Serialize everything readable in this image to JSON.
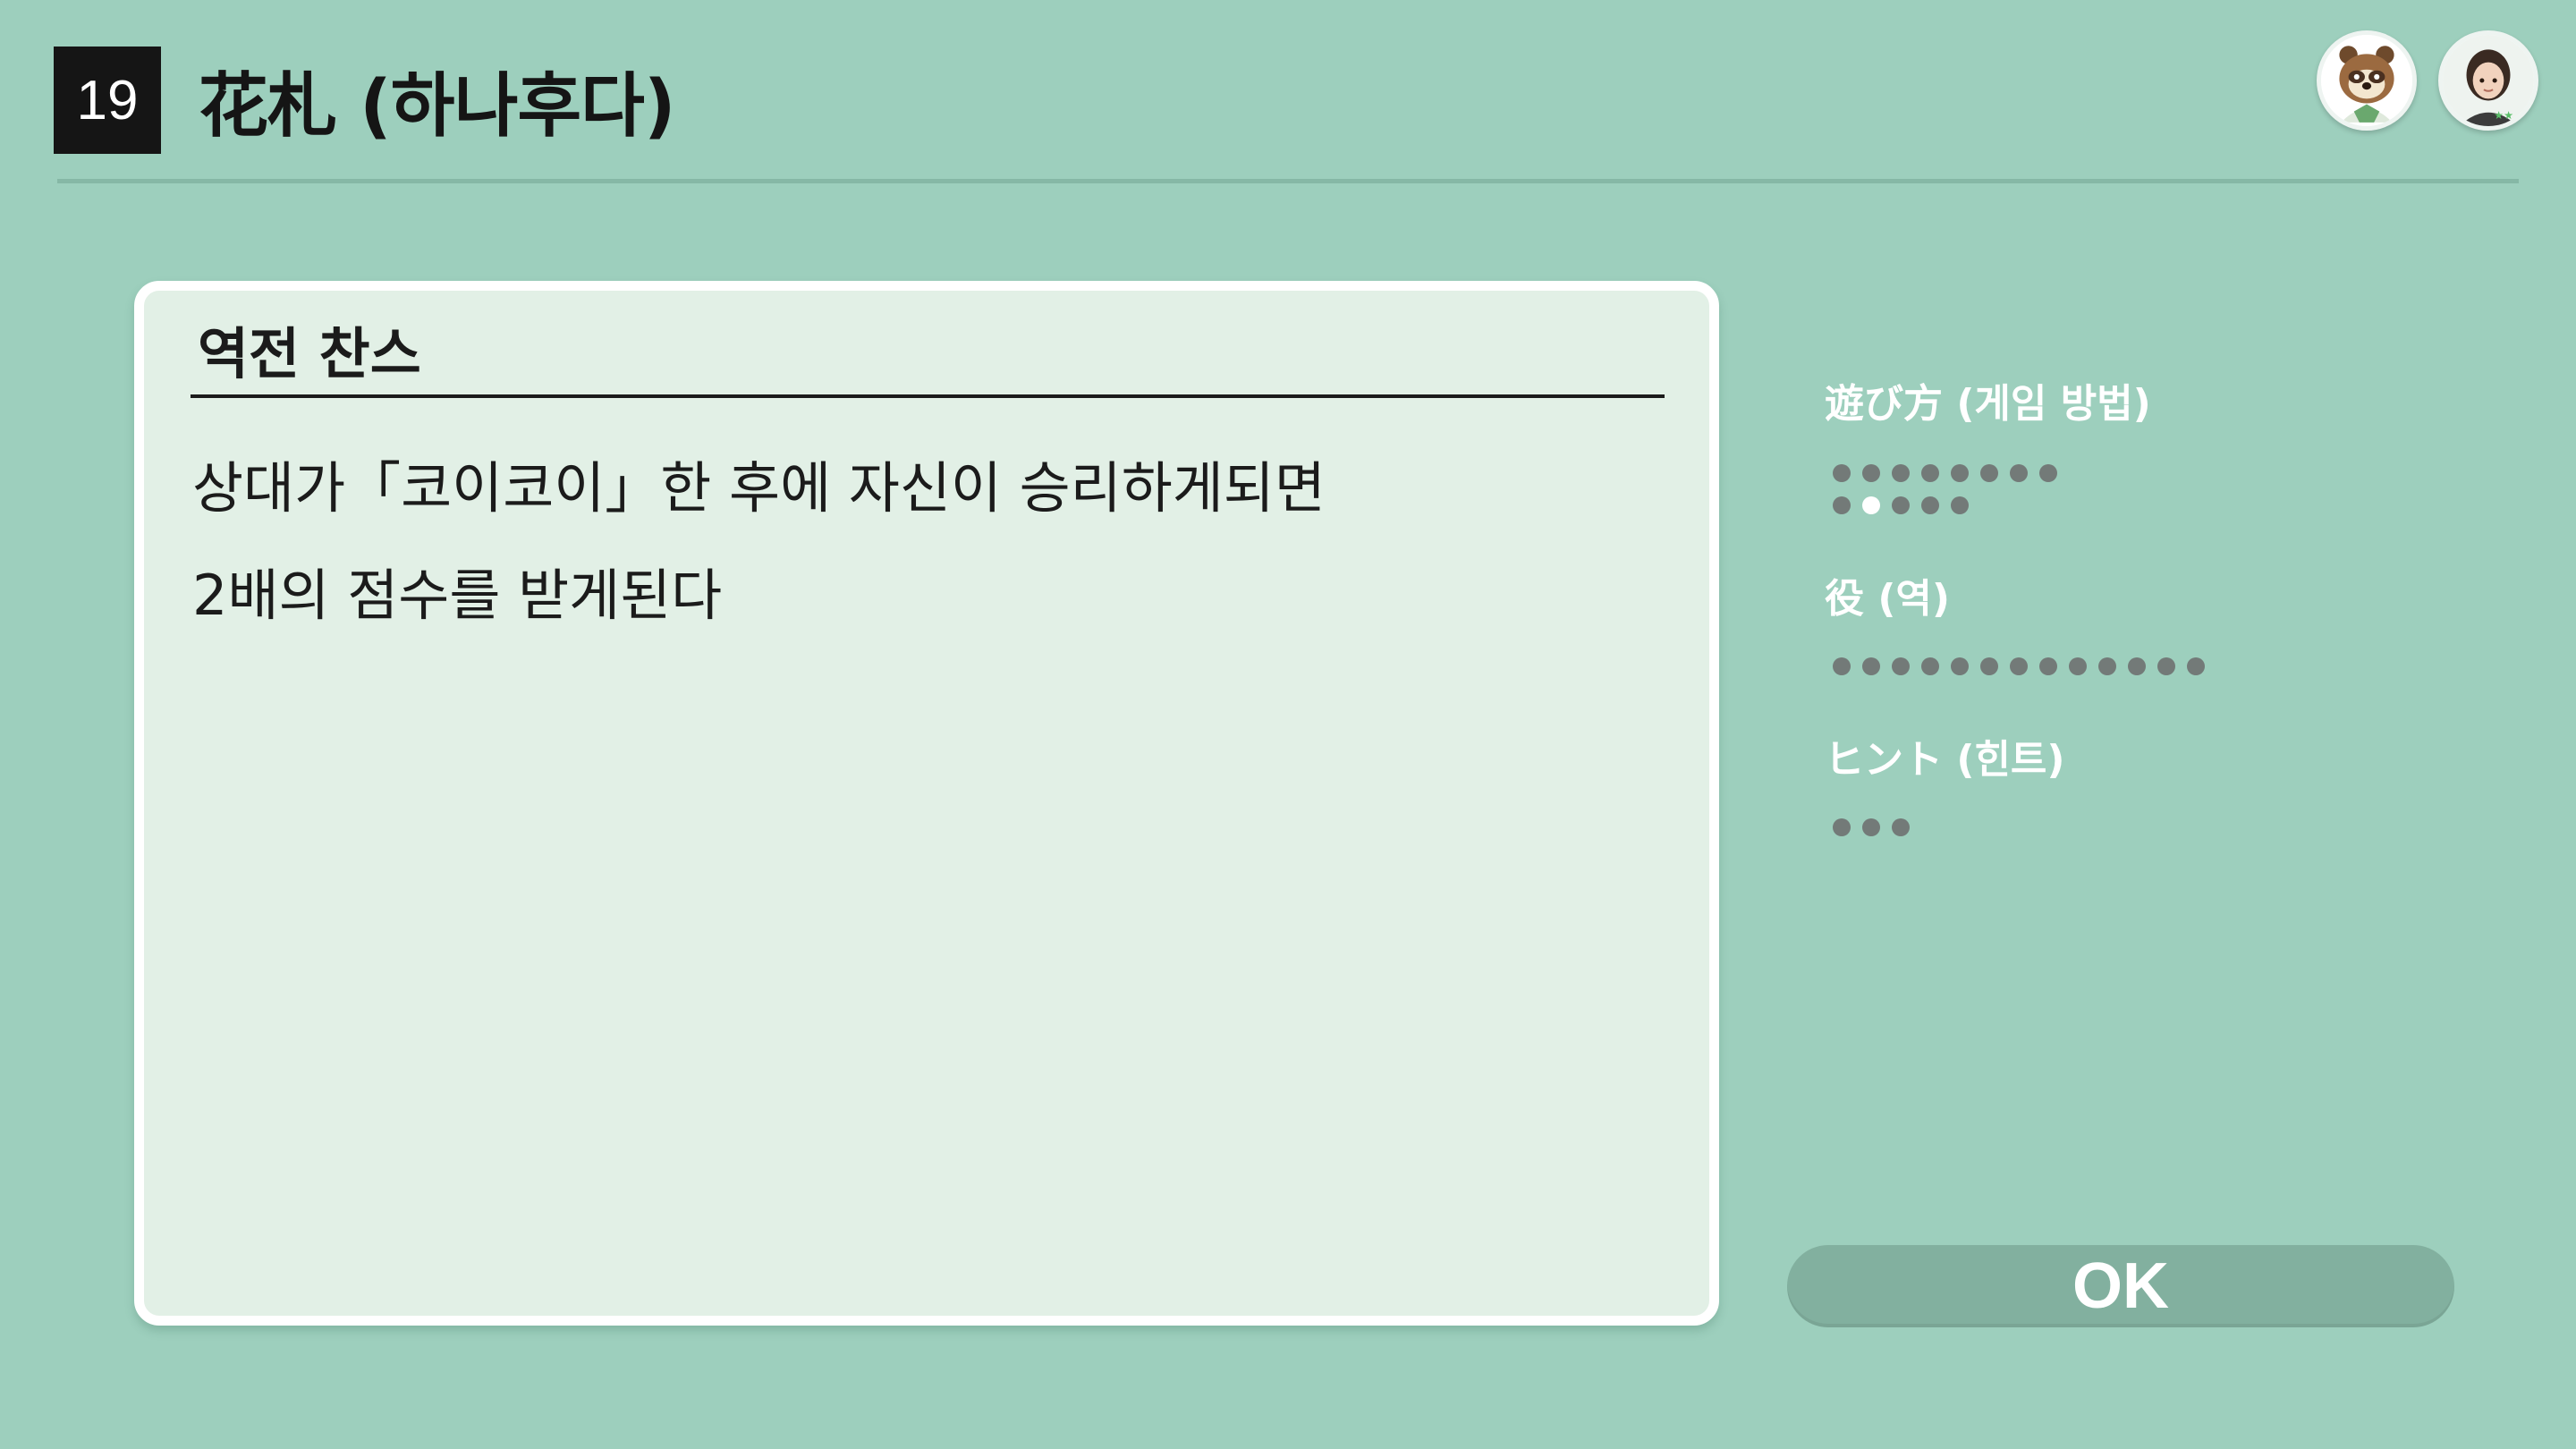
{
  "header": {
    "game_number": "19",
    "game_title": "花札 (하나후다)"
  },
  "players": [
    {
      "icon": "tanuki-character-icon"
    },
    {
      "icon": "player-character-icon"
    }
  ],
  "card": {
    "title": "역전 찬스",
    "lines": [
      "상대가「코이코이」한 후에 자신이 승리하게되면",
      "2배의 점수를 받게된다"
    ]
  },
  "menu": {
    "items": [
      {
        "label": "遊び方 (게임 방법)",
        "active": true,
        "pages": [
          8,
          5
        ],
        "current_page": 10
      },
      {
        "label": "役 (역)",
        "active": false,
        "pages": [
          13
        ],
        "current_page": null
      },
      {
        "label": "ヒント (힌트)",
        "active": false,
        "pages": [
          3
        ],
        "current_page": null
      }
    ]
  },
  "ok_button": {
    "label": "OK"
  },
  "colors": {
    "background": "#9dcfbd",
    "card_fill": "#e2f0e6",
    "dot_inactive": "#737a78",
    "dot_active": "#ffffff",
    "ok_fill": "#82b09f"
  }
}
